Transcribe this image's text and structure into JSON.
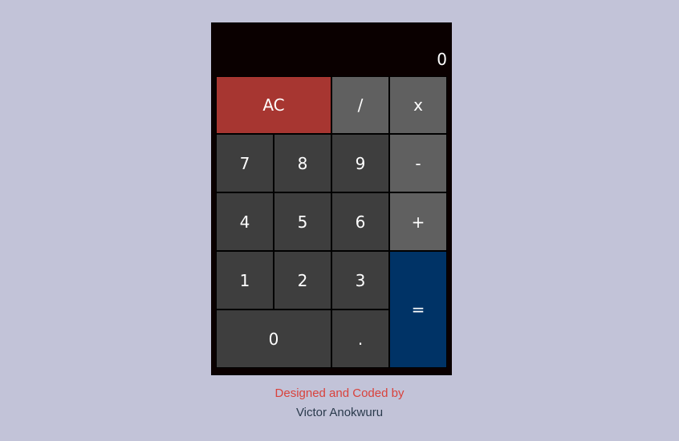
{
  "display": {
    "value": "0"
  },
  "keys": {
    "clear": "AC",
    "divide": "/",
    "multiply": "x",
    "seven": "7",
    "eight": "8",
    "nine": "9",
    "subtract": "-",
    "four": "4",
    "five": "5",
    "six": "6",
    "add": "+",
    "one": "1",
    "two": "2",
    "three": "3",
    "equals": "=",
    "zero": "0",
    "decimal": "."
  },
  "footer": {
    "line1": "Designed and Coded by",
    "line2": "Victor Anokwuru"
  },
  "colors": {
    "background": "#c2c3d8",
    "calculator_body": "#0a0000",
    "number_key": "#3e3e3e",
    "operator_key": "#606060",
    "clear_key": "#a73631",
    "equals_key": "#003366",
    "footer_line1": "#d9423c",
    "footer_line2": "#2a3a4c"
  }
}
